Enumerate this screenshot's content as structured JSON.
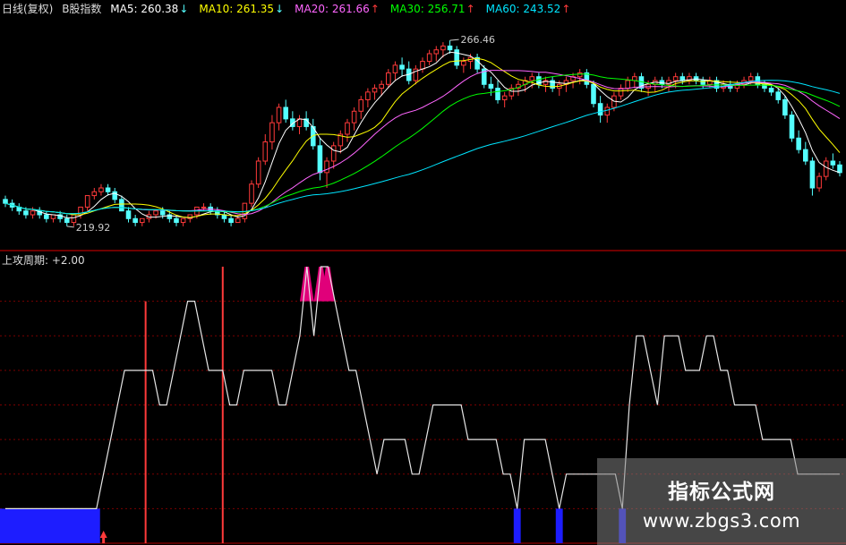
{
  "header": {
    "period_label": "日线(复权)",
    "stock_label": "B股指数",
    "ma": [
      {
        "name": "MA5",
        "value": "260.38",
        "arrow": "↓",
        "color": "#ffffff"
      },
      {
        "name": "MA10",
        "value": "261.35",
        "arrow": "↓",
        "color": "#ffff00"
      },
      {
        "name": "MA20",
        "value": "261.66",
        "arrow": "↑",
        "color": "#ff66ff"
      },
      {
        "name": "MA30",
        "value": "256.71",
        "arrow": "↑",
        "color": "#00ff00"
      },
      {
        "name": "MA60",
        "value": "243.52",
        "arrow": "↑",
        "color": "#00e5ff"
      }
    ]
  },
  "chart_data": [
    {
      "type": "candlestick",
      "title": "日线(复权)",
      "annotations": {
        "high": "266.46",
        "low": "219.92"
      },
      "ylim": [
        214,
        270
      ],
      "candles": [
        [
          225,
          226,
          223,
          224
        ],
        [
          224,
          225,
          222,
          223
        ],
        [
          223,
          224,
          221,
          222
        ],
        [
          222,
          223,
          220,
          221
        ],
        [
          221,
          223,
          220,
          222
        ],
        [
          222,
          223,
          220,
          221
        ],
        [
          221,
          222,
          219,
          220
        ],
        [
          220,
          221,
          219,
          221
        ],
        [
          221,
          222,
          219,
          220
        ],
        [
          220,
          221,
          218,
          219
        ],
        [
          219,
          221,
          218,
          221
        ],
        [
          221,
          223,
          220,
          223
        ],
        [
          223,
          226,
          222,
          226
        ],
        [
          226,
          228,
          225,
          227
        ],
        [
          227,
          229,
          226,
          228
        ],
        [
          228,
          229,
          226,
          227
        ],
        [
          227,
          228,
          224,
          225
        ],
        [
          225,
          226,
          222,
          222
        ],
        [
          222,
          223,
          219,
          220
        ],
        [
          220,
          221,
          218,
          219
        ],
        [
          219,
          220,
          218,
          220
        ],
        [
          220,
          222,
          219,
          221
        ],
        [
          221,
          222,
          220,
          222
        ],
        [
          222,
          223,
          220,
          221
        ],
        [
          221,
          222,
          219,
          220
        ],
        [
          220,
          221,
          218,
          219
        ],
        [
          219,
          220,
          218,
          220
        ],
        [
          220,
          221,
          219,
          221
        ],
        [
          221,
          223,
          220,
          223
        ],
        [
          223,
          224,
          222,
          223
        ],
        [
          223,
          224,
          221,
          222
        ],
        [
          222,
          223,
          220,
          221
        ],
        [
          221,
          222,
          219,
          220
        ],
        [
          220,
          221,
          218,
          219
        ],
        [
          219,
          221,
          219,
          220
        ],
        [
          220,
          224,
          219,
          224
        ],
        [
          224,
          230,
          223,
          229
        ],
        [
          229,
          236,
          228,
          235
        ],
        [
          235,
          242,
          234,
          240
        ],
        [
          240,
          247,
          238,
          245
        ],
        [
          245,
          250,
          243,
          249
        ],
        [
          249,
          251,
          245,
          246
        ],
        [
          246,
          248,
          243,
          244
        ],
        [
          244,
          247,
          242,
          246
        ],
        [
          246,
          248,
          243,
          244
        ],
        [
          244,
          246,
          238,
          239
        ],
        [
          239,
          241,
          230,
          232
        ],
        [
          232,
          236,
          228,
          235
        ],
        [
          235,
          240,
          233,
          239
        ],
        [
          239,
          243,
          237,
          242
        ],
        [
          242,
          246,
          240,
          245
        ],
        [
          245,
          249,
          243,
          248
        ],
        [
          248,
          252,
          246,
          251
        ],
        [
          251,
          254,
          249,
          253
        ],
        [
          253,
          255,
          251,
          254
        ],
        [
          254,
          256,
          252,
          255
        ],
        [
          255,
          259,
          254,
          258
        ],
        [
          258,
          261,
          256,
          260
        ],
        [
          260,
          262,
          257,
          259
        ],
        [
          259,
          261,
          255,
          256
        ],
        [
          256,
          260,
          255,
          259
        ],
        [
          259,
          262,
          258,
          261
        ],
        [
          261,
          264,
          260,
          263
        ],
        [
          263,
          265,
          261,
          264
        ],
        [
          264,
          266,
          262,
          265
        ],
        [
          265,
          266.46,
          263,
          264
        ],
        [
          264,
          265,
          259,
          260
        ],
        [
          260,
          262,
          258,
          261
        ],
        [
          261,
          263,
          259,
          262
        ],
        [
          262,
          263,
          258,
          259
        ],
        [
          259,
          260,
          254,
          255
        ],
        [
          255,
          257,
          252,
          254
        ],
        [
          254,
          256,
          250,
          251
        ],
        [
          251,
          253,
          249,
          252
        ],
        [
          252,
          255,
          251,
          254
        ],
        [
          254,
          256,
          252,
          255
        ],
        [
          255,
          257,
          253,
          256
        ],
        [
          256,
          258,
          254,
          257
        ],
        [
          257,
          258,
          254,
          255
        ],
        [
          255,
          257,
          253,
          256
        ],
        [
          256,
          257,
          253,
          254
        ],
        [
          254,
          256,
          252,
          255
        ],
        [
          255,
          257,
          253,
          256
        ],
        [
          256,
          258,
          254,
          257
        ],
        [
          257,
          259,
          255,
          258
        ],
        [
          258,
          259,
          254,
          255
        ],
        [
          255,
          256,
          249,
          250
        ],
        [
          250,
          252,
          245,
          247
        ],
        [
          247,
          250,
          245,
          249
        ],
        [
          249,
          253,
          248,
          252
        ],
        [
          252,
          255,
          251,
          254
        ],
        [
          254,
          257,
          253,
          256
        ],
        [
          256,
          258,
          254,
          257
        ],
        [
          257,
          258,
          253,
          254
        ],
        [
          254,
          256,
          252,
          255
        ],
        [
          255,
          257,
          253,
          256
        ],
        [
          256,
          257,
          254,
          255
        ],
        [
          255,
          257,
          253,
          256
        ],
        [
          256,
          258,
          254,
          257
        ],
        [
          257,
          258,
          255,
          256
        ],
        [
          256,
          258,
          255,
          257
        ],
        [
          257,
          258,
          255,
          256
        ],
        [
          256,
          257,
          254,
          255
        ],
        [
          255,
          257,
          254,
          256
        ],
        [
          256,
          257,
          253,
          254
        ],
        [
          254,
          256,
          253,
          255
        ],
        [
          255,
          256,
          253,
          254
        ],
        [
          254,
          256,
          253,
          255
        ],
        [
          255,
          257,
          254,
          256
        ],
        [
          256,
          258,
          255,
          257
        ],
        [
          257,
          258,
          254,
          255
        ],
        [
          255,
          256,
          253,
          254
        ],
        [
          254,
          255,
          252,
          253
        ],
        [
          253,
          254,
          250,
          251
        ],
        [
          251,
          252,
          246,
          247
        ],
        [
          247,
          248,
          240,
          241
        ],
        [
          241,
          243,
          237,
          238
        ],
        [
          238,
          240,
          234,
          235
        ],
        [
          235,
          236,
          226,
          228
        ],
        [
          228,
          232,
          227,
          231
        ],
        [
          231,
          236,
          230,
          235
        ],
        [
          235,
          237,
          233,
          234
        ],
        [
          234,
          235,
          231,
          232
        ]
      ]
    },
    {
      "type": "line",
      "title": "上攻周期",
      "value_label": "+2.00",
      "ylim": [
        0,
        8
      ],
      "levels": [
        1,
        1,
        1,
        1,
        1,
        1,
        1,
        1,
        1,
        1,
        1,
        1,
        1,
        1,
        2,
        3,
        4,
        5,
        5,
        5,
        5,
        5,
        4,
        4,
        5,
        6,
        7,
        7,
        6,
        5,
        5,
        5,
        4,
        4,
        5,
        5,
        5,
        5,
        5,
        4,
        4,
        5,
        6,
        8,
        6,
        8,
        8,
        7,
        6,
        5,
        5,
        4,
        3,
        2,
        3,
        3,
        3,
        3,
        2,
        2,
        3,
        4,
        4,
        4,
        4,
        4,
        3,
        3,
        3,
        3,
        3,
        2,
        2,
        1,
        3,
        3,
        3,
        3,
        2,
        1,
        2,
        2,
        2,
        2,
        2,
        2,
        2,
        2,
        1,
        4,
        6,
        6,
        5,
        4,
        6,
        6,
        6,
        5,
        5,
        5,
        6,
        6,
        5,
        5,
        4,
        4,
        4,
        4,
        3,
        3,
        3,
        3,
        3,
        2,
        2,
        2,
        2,
        2,
        2,
        2
      ],
      "bars": [
        {
          "index": 20,
          "value": 1
        },
        {
          "index": 31,
          "value": 2
        }
      ],
      "signal_index": 14
    }
  ],
  "watermark": {
    "title": "指标公式网",
    "url": "www.zbgs3.com"
  },
  "colors": {
    "up": "#ff3a3a",
    "down": "#54ffff",
    "grid": "#7a0000",
    "sep": "#b00000",
    "fill_magenta": "#e0007a",
    "fill_blue": "#1d1dff",
    "line": "#e6e6e6"
  }
}
